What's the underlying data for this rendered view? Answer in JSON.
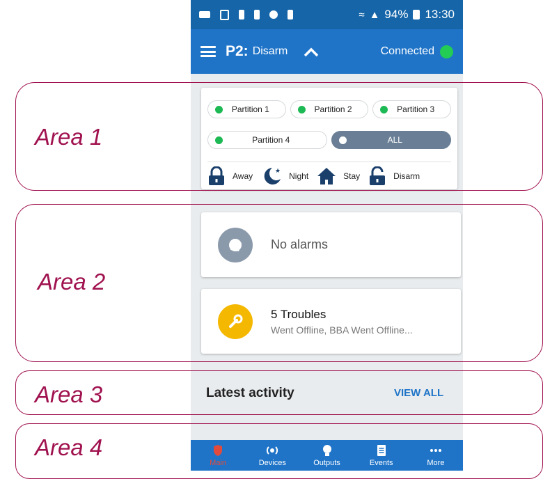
{
  "status_bar": {
    "battery": "94%",
    "time": "13:30"
  },
  "app_bar": {
    "partition_label": "P2:",
    "partition_state": "Disarm",
    "connection": "Connected"
  },
  "partitions": {
    "items": [
      {
        "label": "Partition 1"
      },
      {
        "label": "Partition 2"
      },
      {
        "label": "Partition 3"
      },
      {
        "label": "Partition 4"
      }
    ],
    "all_label": "ALL"
  },
  "modes": [
    {
      "label": "Away"
    },
    {
      "label": "Night"
    },
    {
      "label": "Stay"
    },
    {
      "label": "Disarm"
    }
  ],
  "alarms": {
    "text": "No alarms"
  },
  "troubles": {
    "title": "5 Troubles",
    "subtitle": "Went Offline, BBA Went Offline..."
  },
  "activity": {
    "title": "Latest activity",
    "view_all": "VIEW ALL"
  },
  "nav": [
    {
      "label": "Main"
    },
    {
      "label": "Devices"
    },
    {
      "label": "Outputs"
    },
    {
      "label": "Events"
    },
    {
      "label": "More"
    }
  ],
  "areas": [
    {
      "label": "Area 1"
    },
    {
      "label": "Area 2"
    },
    {
      "label": "Area 3"
    },
    {
      "label": "Area 4"
    }
  ],
  "colors": {
    "primary": "#1f74c8",
    "status_bar": "#1565a8",
    "annotation": "#a0124f",
    "active_nav": "#e24b3c",
    "connected": "#22cc55"
  }
}
